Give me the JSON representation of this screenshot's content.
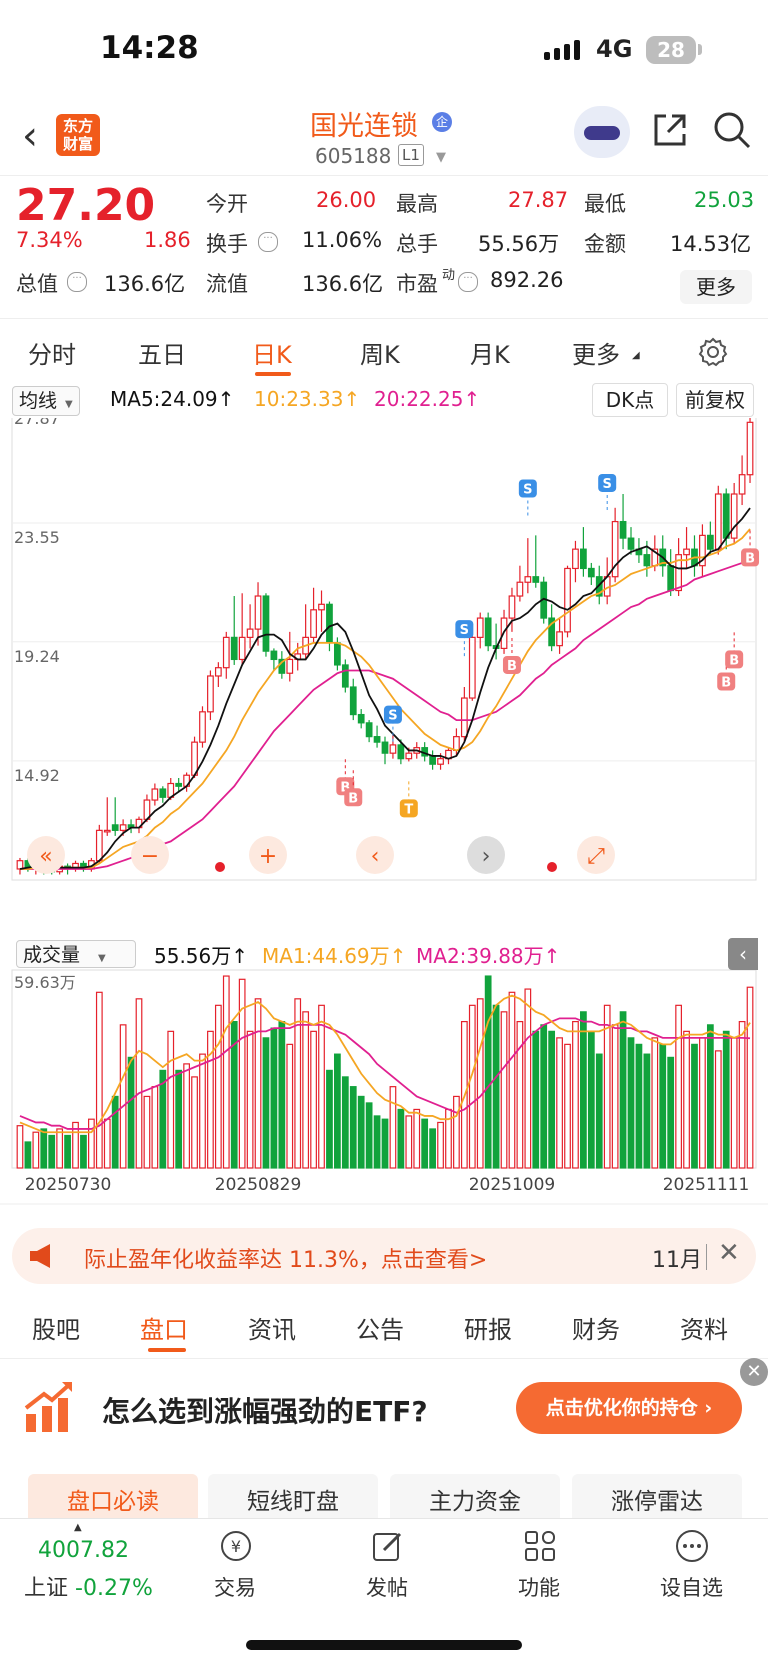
{
  "status": {
    "time": "14:28",
    "network": "4G",
    "battery": "28"
  },
  "header": {
    "logo": "东方财富",
    "stock_name": "国光连锁",
    "badge": "企",
    "code": "605188",
    "level": "L1"
  },
  "quote": {
    "price": "27.20",
    "pct": "7.34%",
    "change": "1.86",
    "open_label": "今开",
    "open": "26.00",
    "high_label": "最高",
    "high": "27.87",
    "low_label": "最低",
    "low": "25.03",
    "turnover_label": "换手",
    "turnover": "11.06%",
    "volume_label": "总手",
    "volume": "55.56万",
    "amount_label": "金额",
    "amount": "14.53亿",
    "mktcap_label": "总值",
    "mktcap": "136.6亿",
    "float_label": "流值",
    "float": "136.6亿",
    "pe_label": "市盈",
    "pe_sup": "动",
    "pe": "892.26",
    "more_button": "更多"
  },
  "tabs": [
    "分时",
    "五日",
    "日K",
    "周K",
    "月K",
    "更多"
  ],
  "indicator": {
    "select": "均线",
    "ma5": "MA5:24.09↑",
    "ma10": "10:23.33↑",
    "ma20": "20:22.25↑",
    "dk_button": "DK点",
    "restore_button": "前复权"
  },
  "volume_panel": {
    "select": "成交量",
    "vol": "55.56万↑",
    "ma1": "MA1:44.69万↑",
    "ma2": "MA2:39.88万↑",
    "max_label": "59.63万"
  },
  "banner": {
    "text": "际止盈年化收益率达 11.3%，点击查看>",
    "month": "11月",
    "close": "✕"
  },
  "bottom_tabs": [
    "股吧",
    "盘口",
    "资讯",
    "公告",
    "研报",
    "财务",
    "资料"
  ],
  "ad": {
    "title": "怎么选到涨幅强劲的ETF?",
    "button": "点击优化你的持仓 ›",
    "close": "✕"
  },
  "pills": [
    "盘口必读",
    "短线盯盘",
    "主力资金",
    "涨停雷达"
  ],
  "nav": {
    "index_value": "4007.82",
    "index_name": "上证",
    "index_change": "-0.27%",
    "items": [
      "交易",
      "发帖",
      "功能",
      "设自选"
    ]
  },
  "chart_data": {
    "type": "candlestick",
    "price_ticks": [
      "27.87",
      "23.55",
      "19.24",
      "14.92"
    ],
    "date_ticks": [
      "20250730",
      "20250829",
      "20251009",
      "20251111"
    ],
    "current_price": 27.2,
    "ylim": [
      10.6,
      28.3
    ],
    "candles": [
      [
        11.0,
        11.3,
        10.8,
        11.4
      ],
      [
        11.3,
        11.0,
        10.9,
        11.4
      ],
      [
        11.0,
        11.1,
        10.8,
        11.2
      ],
      [
        11.1,
        11.0,
        10.8,
        11.2
      ],
      [
        11.0,
        10.9,
        10.8,
        11.1
      ],
      [
        10.9,
        11.1,
        10.8,
        11.2
      ],
      [
        11.1,
        11.0,
        10.8,
        11.2
      ],
      [
        11.0,
        11.2,
        10.9,
        11.3
      ],
      [
        11.2,
        11.0,
        10.9,
        11.3
      ],
      [
        11.0,
        11.3,
        10.9,
        11.4
      ],
      [
        11.3,
        12.4,
        11.2,
        12.6
      ],
      [
        12.4,
        12.4,
        12.2,
        13.6
      ],
      [
        12.6,
        12.4,
        12.2,
        13.6
      ],
      [
        12.4,
        12.6,
        12.2,
        12.8
      ],
      [
        12.6,
        12.5,
        12.3,
        12.8
      ],
      [
        12.5,
        12.8,
        12.3,
        12.9
      ],
      [
        12.8,
        13.5,
        12.7,
        13.7
      ],
      [
        13.5,
        13.9,
        13.3,
        14.1
      ],
      [
        13.9,
        13.6,
        13.4,
        14.0
      ],
      [
        13.6,
        14.1,
        13.5,
        14.3
      ],
      [
        14.1,
        14.0,
        13.8,
        14.3
      ],
      [
        14.0,
        14.4,
        13.8,
        14.5
      ],
      [
        14.4,
        15.6,
        14.3,
        15.8
      ],
      [
        15.6,
        16.7,
        15.4,
        16.9
      ],
      [
        16.7,
        18.0,
        16.4,
        18.2
      ],
      [
        18.0,
        18.3,
        17.6,
        18.5
      ],
      [
        18.3,
        19.4,
        17.9,
        19.6
      ],
      [
        19.4,
        18.6,
        18.4,
        20.9
      ],
      [
        18.6,
        19.4,
        18.4,
        21.0
      ],
      [
        19.4,
        19.7,
        19.0,
        20.6
      ],
      [
        19.7,
        20.9,
        19.1,
        21.4
      ],
      [
        20.9,
        18.9,
        18.7,
        21.0
      ],
      [
        18.9,
        18.6,
        18.2,
        19.0
      ],
      [
        18.6,
        18.1,
        17.9,
        18.9
      ],
      [
        18.1,
        18.6,
        17.8,
        19.6
      ],
      [
        18.6,
        18.8,
        18.2,
        19.2
      ],
      [
        18.8,
        19.4,
        18.6,
        20.6
      ],
      [
        19.4,
        20.4,
        19.2,
        21.2
      ],
      [
        20.4,
        20.6,
        19.6,
        21.1
      ],
      [
        20.6,
        19.2,
        18.9,
        20.7
      ],
      [
        19.2,
        18.4,
        18.2,
        19.4
      ],
      [
        18.4,
        17.6,
        17.4,
        18.6
      ],
      [
        17.6,
        16.6,
        16.4,
        17.9
      ],
      [
        16.6,
        16.3,
        16.1,
        16.8
      ],
      [
        16.3,
        15.8,
        15.6,
        16.4
      ],
      [
        15.8,
        15.6,
        15.4,
        16.2
      ],
      [
        15.6,
        15.2,
        14.8,
        15.8
      ],
      [
        15.2,
        15.5,
        15.0,
        15.9
      ],
      [
        15.5,
        15.0,
        14.8,
        15.7
      ],
      [
        15.0,
        15.2,
        14.9,
        15.4
      ],
      [
        15.2,
        15.4,
        15.0,
        15.6
      ],
      [
        15.4,
        15.1,
        14.9,
        15.6
      ],
      [
        15.1,
        14.8,
        14.6,
        15.3
      ],
      [
        14.8,
        15.0,
        14.6,
        15.2
      ],
      [
        15.0,
        15.3,
        14.8,
        15.4
      ],
      [
        15.3,
        15.8,
        15.1,
        16.1
      ],
      [
        15.8,
        17.2,
        15.6,
        17.6
      ],
      [
        17.2,
        19.4,
        17.1,
        19.6
      ],
      [
        19.4,
        20.1,
        19.0,
        20.3
      ],
      [
        20.1,
        19.1,
        18.9,
        20.3
      ],
      [
        19.1,
        19.0,
        18.6,
        19.9
      ],
      [
        19.0,
        20.1,
        18.8,
        20.4
      ],
      [
        20.1,
        20.9,
        19.6,
        21.2
      ],
      [
        20.9,
        21.4,
        20.7,
        22.0
      ],
      [
        21.4,
        21.6,
        21.0,
        23.0
      ],
      [
        21.6,
        21.4,
        21.2,
        23.1
      ],
      [
        21.4,
        20.1,
        19.9,
        21.6
      ],
      [
        20.1,
        19.1,
        18.9,
        20.6
      ],
      [
        19.1,
        19.6,
        18.8,
        20.1
      ],
      [
        19.6,
        21.9,
        19.4,
        22.0
      ],
      [
        21.9,
        22.6,
        21.4,
        22.9
      ],
      [
        22.6,
        21.9,
        21.6,
        23.4
      ],
      [
        21.9,
        21.6,
        21.3,
        22.1
      ],
      [
        21.6,
        20.9,
        20.6,
        22.0
      ],
      [
        20.9,
        21.6,
        20.6,
        22.3
      ],
      [
        21.6,
        23.6,
        21.4,
        24.1
      ],
      [
        23.6,
        23.0,
        22.6,
        24.6
      ],
      [
        23.0,
        22.6,
        22.4,
        23.4
      ],
      [
        22.6,
        22.4,
        22.1,
        23.0
      ],
      [
        22.4,
        22.0,
        21.6,
        22.9
      ],
      [
        22.0,
        22.6,
        21.8,
        23.1
      ],
      [
        22.6,
        22.0,
        21.6,
        23.1
      ],
      [
        22.0,
        21.1,
        20.9,
        22.6
      ],
      [
        21.1,
        22.4,
        20.9,
        23.0
      ],
      [
        22.4,
        22.6,
        21.9,
        23.4
      ],
      [
        22.6,
        22.0,
        21.6,
        23.1
      ],
      [
        22.0,
        23.1,
        21.6,
        23.5
      ],
      [
        23.1,
        22.6,
        22.4,
        23.6
      ],
      [
        22.6,
        24.6,
        22.4,
        24.9
      ],
      [
        24.6,
        23.0,
        22.6,
        24.8
      ],
      [
        23.0,
        24.6,
        22.8,
        25.0
      ],
      [
        24.6,
        25.3,
        24.2,
        26.0
      ],
      [
        25.3,
        27.2,
        25.0,
        27.87
      ]
    ],
    "ma5": [
      11.0,
      11.05,
      11.1,
      11.1,
      11.1,
      11.05,
      11.05,
      11.05,
      11.05,
      11.1,
      11.3,
      11.6,
      12.0,
      12.3,
      12.5,
      12.5,
      12.8,
      13.1,
      13.3,
      13.6,
      13.8,
      14.0,
      14.4,
      14.9,
      15.5,
      16.2,
      17.0,
      17.7,
      18.4,
      18.9,
      19.4,
      19.5,
      19.5,
      19.3,
      18.8,
      18.6,
      18.6,
      19.0,
      19.5,
      19.8,
      19.9,
      19.6,
      18.9,
      18.1,
      17.3,
      16.8,
      16.2,
      15.9,
      15.6,
      15.3,
      15.3,
      15.2,
      15.1,
      15.1,
      15.0,
      15.1,
      15.6,
      16.4,
      17.4,
      18.3,
      19.0,
      19.6,
      20.0,
      20.1,
      20.3,
      20.6,
      20.8,
      20.7,
      20.5,
      20.4,
      20.6,
      20.9,
      21.0,
      21.3,
      21.6,
      22.0,
      22.3,
      22.5,
      22.6,
      22.7,
      22.5,
      22.3,
      22.0,
      21.9,
      21.9,
      22.0,
      22.2,
      22.5,
      22.6,
      23.0,
      23.4,
      23.7,
      24.09
    ],
    "ma10": [
      11.0,
      11.0,
      11.05,
      11.05,
      11.05,
      11.05,
      11.05,
      11.05,
      11.05,
      11.05,
      11.2,
      11.4,
      11.6,
      11.8,
      11.9,
      12.0,
      12.2,
      12.5,
      12.7,
      13.0,
      13.2,
      13.5,
      13.8,
      14.1,
      14.5,
      14.9,
      15.3,
      15.8,
      16.4,
      16.9,
      17.4,
      17.8,
      18.2,
      18.5,
      18.7,
      19.0,
      19.1,
      19.2,
      19.2,
      19.2,
      19.2,
      19.1,
      18.9,
      18.7,
      18.4,
      18.0,
      17.6,
      17.2,
      16.8,
      16.5,
      16.2,
      15.9,
      15.7,
      15.5,
      15.4,
      15.3,
      15.4,
      15.6,
      16.0,
      16.5,
      16.9,
      17.4,
      17.9,
      18.4,
      18.9,
      19.3,
      19.6,
      19.9,
      20.1,
      20.3,
      20.5,
      20.7,
      20.9,
      21.0,
      21.2,
      21.3,
      21.5,
      21.7,
      21.8,
      21.9,
      22.0,
      22.1,
      22.1,
      22.2,
      22.2,
      22.3,
      22.3,
      22.4,
      22.5,
      22.7,
      22.8,
      23.0,
      23.33
    ],
    "ma20": [
      11.0,
      11.0,
      11.0,
      11.0,
      11.0,
      11.0,
      11.0,
      11.0,
      11.0,
      11.0,
      11.05,
      11.1,
      11.2,
      11.3,
      11.4,
      11.5,
      11.6,
      11.8,
      11.9,
      12.0,
      12.2,
      12.4,
      12.6,
      12.8,
      13.1,
      13.4,
      13.7,
      14.0,
      14.4,
      14.8,
      15.2,
      15.6,
      16.0,
      16.3,
      16.6,
      16.9,
      17.2,
      17.5,
      17.7,
      17.9,
      18.1,
      18.2,
      18.2,
      18.2,
      18.2,
      18.1,
      18.0,
      17.9,
      17.7,
      17.5,
      17.3,
      17.1,
      16.9,
      16.7,
      16.6,
      16.4,
      16.4,
      16.4,
      16.5,
      16.6,
      16.7,
      16.9,
      17.1,
      17.3,
      17.6,
      17.9,
      18.1,
      18.4,
      18.6,
      18.8,
      19.0,
      19.3,
      19.5,
      19.7,
      19.9,
      20.1,
      20.3,
      20.5,
      20.6,
      20.8,
      20.9,
      21.0,
      21.1,
      21.2,
      21.3,
      21.5,
      21.6,
      21.7,
      21.8,
      21.9,
      22.0,
      22.1,
      22.25
    ],
    "volumes": [
      13,
      8,
      11,
      12,
      10,
      12,
      10,
      14,
      10,
      15,
      54,
      15,
      22,
      44,
      34,
      52,
      22,
      25,
      30,
      42,
      30,
      32,
      28,
      35,
      42,
      50,
      59,
      45,
      58,
      42,
      52,
      40,
      43,
      45,
      38,
      52,
      48,
      42,
      50,
      30,
      35,
      28,
      25,
      22,
      20,
      16,
      15,
      25,
      18,
      16,
      18,
      15,
      12,
      14,
      18,
      22,
      45,
      50,
      52,
      59,
      50,
      48,
      54,
      45,
      55,
      42,
      44,
      42,
      40,
      38,
      45,
      48,
      42,
      35,
      50,
      44,
      48,
      40,
      38,
      35,
      40,
      38,
      34,
      50,
      42,
      38,
      40,
      44,
      36,
      42,
      40,
      45,
      55.56
    ],
    "vol_ma1": [
      14,
      13,
      12,
      11,
      11,
      11,
      11,
      11,
      11,
      11,
      14,
      18,
      23,
      28,
      33,
      36,
      35,
      33,
      31,
      33,
      34,
      35,
      33,
      33,
      35,
      38,
      43,
      46,
      49,
      50,
      51,
      49,
      46,
      45,
      44,
      45,
      45,
      44,
      45,
      44,
      41,
      37,
      33,
      29,
      26,
      23,
      21,
      20,
      19,
      17,
      17,
      16,
      16,
      15,
      15,
      16,
      22,
      29,
      37,
      45,
      50,
      52,
      53,
      52,
      50,
      48,
      47,
      45,
      43,
      42,
      42,
      42,
      42,
      42,
      43,
      44,
      45,
      44,
      42,
      40,
      39,
      38,
      38,
      40,
      41,
      41,
      41,
      42,
      41,
      41,
      40,
      41,
      44.69
    ],
    "vol_ma2": [
      16,
      15,
      14,
      14,
      13,
      13,
      12,
      12,
      12,
      12,
      13,
      15,
      17,
      19,
      21,
      23,
      24,
      25,
      26,
      28,
      29,
      30,
      31,
      32,
      33,
      34,
      36,
      38,
      40,
      41,
      42,
      42,
      43,
      43,
      43,
      44,
      44,
      44,
      44,
      43,
      42,
      41,
      39,
      37,
      35,
      32,
      30,
      28,
      26,
      24,
      22,
      21,
      20,
      19,
      18,
      17,
      18,
      20,
      22,
      25,
      28,
      31,
      34,
      37,
      40,
      42,
      44,
      45,
      46,
      46,
      46,
      45,
      45,
      44,
      44,
      43,
      43,
      43,
      42,
      42,
      41,
      40,
      40,
      40,
      40,
      40,
      40,
      40,
      40,
      40,
      40,
      40,
      39.88
    ]
  }
}
